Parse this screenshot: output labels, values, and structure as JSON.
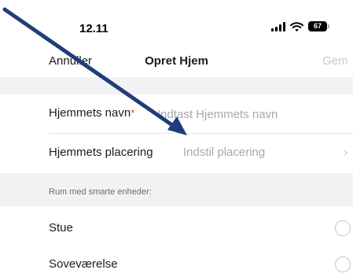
{
  "status_bar": {
    "time": "12.11",
    "battery": "67"
  },
  "nav": {
    "cancel_label": "Annuller",
    "title": "Opret Hjem",
    "save_label": "Gem"
  },
  "form": {
    "home_name": {
      "label": "Hjemmets navn",
      "required_mark": "*",
      "placeholder": "Indtast Hjemmets navn",
      "value": ""
    },
    "home_location": {
      "label": "Hjemmets placering",
      "value": "Indstil placering"
    }
  },
  "rooms": {
    "section_header": "Rum med smarte enheder:",
    "items": [
      {
        "label": "Stue"
      },
      {
        "label": "Soveværelse"
      }
    ]
  },
  "colors": {
    "annotation_arrow": "#1f3d7a",
    "required": "#ff3b30",
    "placeholder": "#a9a9ae"
  },
  "icons": [
    "signal-icon",
    "wifi-icon",
    "battery-icon",
    "chevron-right-icon",
    "radio-icon",
    "annotation-arrow-icon"
  ]
}
